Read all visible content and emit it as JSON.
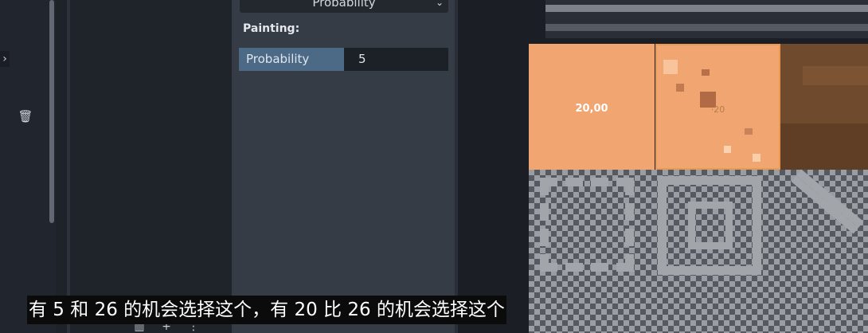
{
  "inspector": {
    "top_dropdown": "Probability",
    "section_label": "Painting:",
    "property": {
      "name": "Probability",
      "value": "5"
    }
  },
  "atlas": {
    "tile_a_label": "20,00",
    "tile_b_label": "·20"
  },
  "subtitle": "有 5 和 26 的机会选择这个，有 20 比 26 的机会选择这个",
  "icons": {
    "left_chevron": "›",
    "trash": "🗑",
    "dropdown_arrow": "⌄",
    "bottom_tools": [
      "trash-icon",
      "add-icon",
      "more-icon",
      "sort-icon"
    ]
  },
  "colors": {
    "accent": "#4c6a86",
    "tile": "#f1a672",
    "panel": "#363c45"
  }
}
